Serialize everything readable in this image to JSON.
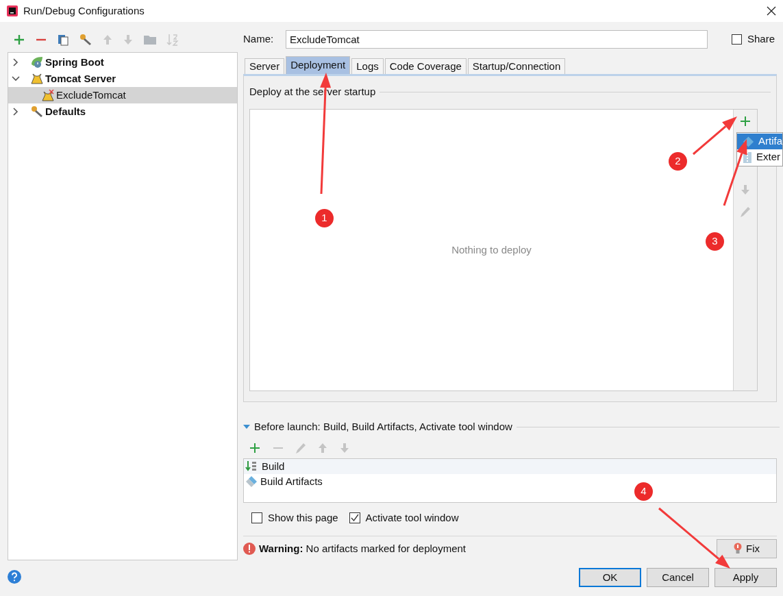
{
  "window": {
    "title": "Run/Debug Configurations"
  },
  "tree": [
    {
      "label": "Spring Boot",
      "expanded": false,
      "selected": false
    },
    {
      "label": "Tomcat Server",
      "expanded": true,
      "selected": false,
      "children": [
        {
          "label": "ExcludeTomcat",
          "selected": true
        }
      ]
    },
    {
      "label": "Defaults",
      "expanded": false,
      "selected": false
    }
  ],
  "name_field": {
    "label": "Name:",
    "value": "ExcludeTomcat"
  },
  "share": {
    "label": "Share",
    "checked": false
  },
  "tabs": [
    {
      "label": "Server",
      "selected": false
    },
    {
      "label": "Deployment",
      "selected": true
    },
    {
      "label": "Logs",
      "selected": false
    },
    {
      "label": "Code Coverage",
      "selected": false
    },
    {
      "label": "Startup/Connection",
      "selected": false
    }
  ],
  "deploy": {
    "heading": "Deploy at the server startup",
    "empty_text": "Nothing to deploy",
    "menu": [
      {
        "label": "Artifa",
        "selected": true
      },
      {
        "label": "Exter",
        "selected": false
      }
    ]
  },
  "before_launch": {
    "heading": "Before launch: Build, Build Artifacts, Activate tool window",
    "expanded": true,
    "tasks": [
      {
        "label": "Build",
        "selected": true
      },
      {
        "label": "Build Artifacts",
        "selected": false
      }
    ]
  },
  "options": [
    {
      "label": "Show this page",
      "checked": false
    },
    {
      "label": "Activate tool window",
      "checked": true
    }
  ],
  "warning": "**Warning:** No artifacts marked for deployment",
  "fix_button": "Fix",
  "buttons": [
    {
      "label": "OK",
      "default": true
    },
    {
      "label": "Cancel",
      "default": false
    },
    {
      "label": "Apply",
      "default": false
    }
  ],
  "annotations": [
    {
      "number": "1"
    },
    {
      "number": "2"
    },
    {
      "number": "3"
    },
    {
      "number": "4"
    }
  ]
}
